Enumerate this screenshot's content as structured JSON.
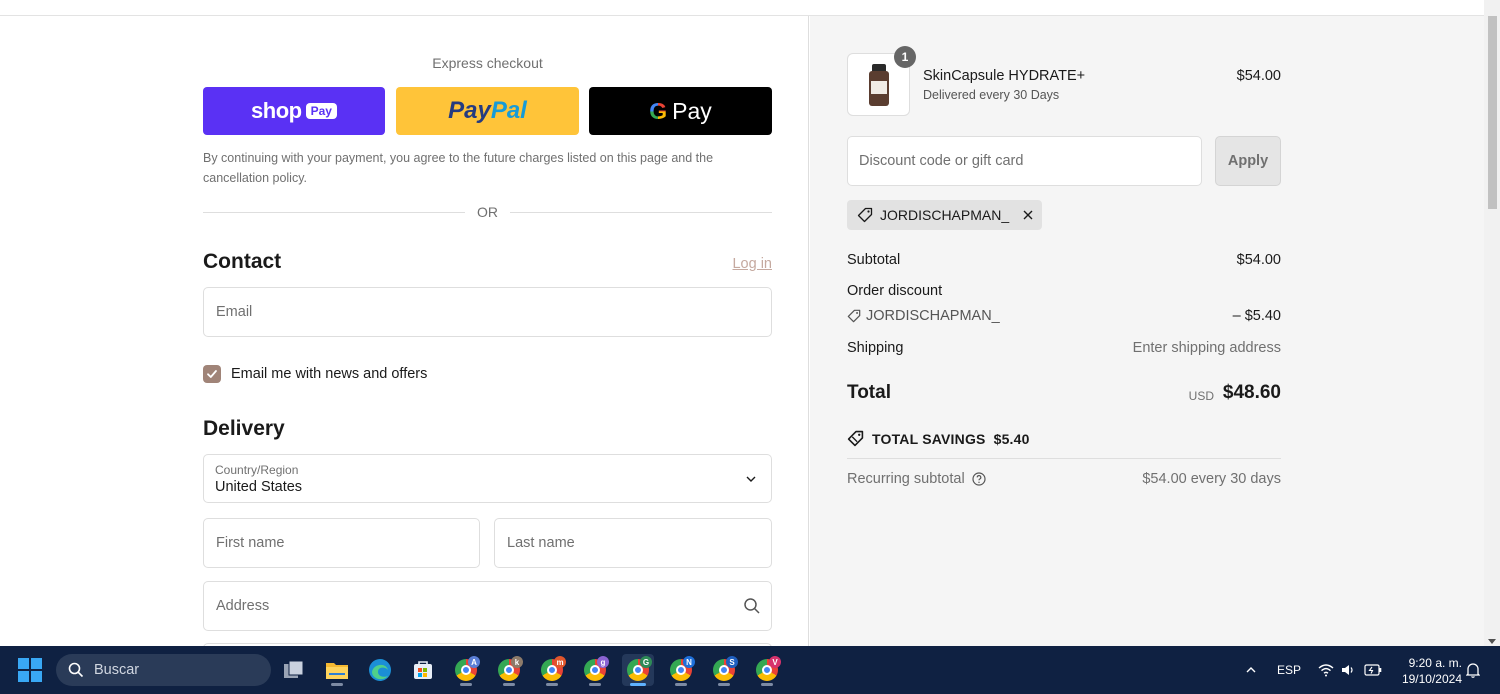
{
  "express": {
    "title": "Express checkout",
    "shop_pay": {
      "text": "shop",
      "badge": "Pay"
    },
    "paypal": {
      "part1": "Pay",
      "part2": "Pal"
    },
    "google_pay": {
      "g": "G",
      "text": "Pay"
    },
    "agreement": "By continuing with your payment, you agree to the future charges listed on this page and the cancellation policy.",
    "or_label": "OR"
  },
  "contact": {
    "heading": "Contact",
    "login_label": "Log in",
    "email_placeholder": "Email",
    "email_value": "",
    "newsletter_label": "Email me with news and offers",
    "newsletter_checked": true
  },
  "delivery": {
    "heading": "Delivery",
    "country_label": "Country/Region",
    "country_value": "United States",
    "first_name_placeholder": "First name",
    "last_name_placeholder": "Last name",
    "address_placeholder": "Address"
  },
  "order": {
    "product": {
      "name": "SkinCapsule HYDRATE+",
      "subtitle": "Delivered every 30 Days",
      "price": "$54.00",
      "quantity": "1"
    },
    "discount_placeholder": "Discount code or gift card",
    "discount_value": "",
    "apply_label": "Apply",
    "applied_code": "JORDISCHAPMAN_",
    "subtotal_label": "Subtotal",
    "subtotal_value": "$54.00",
    "order_discount_label": "Order discount",
    "discount_code": "JORDISCHAPMAN_",
    "discount_amount": "– $5.40",
    "shipping_label": "Shipping",
    "shipping_value": "Enter shipping address",
    "total_label": "Total",
    "total_currency": "USD",
    "total_value": "$48.60",
    "savings_label": "TOTAL SAVINGS",
    "savings_value": "$5.40",
    "recurring_label": "Recurring subtotal",
    "recurring_value": "$54.00 every 30 days"
  },
  "taskbar": {
    "search_label": "Buscar",
    "chrome_profiles": [
      {
        "letter": "A",
        "color": "#5b7fd6"
      },
      {
        "letter": "k",
        "color": "#8d7b6a"
      },
      {
        "letter": "m",
        "color": "#e0562c"
      },
      {
        "letter": "g",
        "color": "#8a63d2"
      },
      {
        "letter": "G",
        "color": "#2e8b57"
      },
      {
        "letter": "N",
        "color": "#1e6fd9"
      },
      {
        "letter": "S",
        "color": "#1f5fbf"
      },
      {
        "letter": "V",
        "color": "#d6336c"
      }
    ],
    "language": "ESP",
    "time": "9:20 a. m.",
    "date": "19/10/2024"
  },
  "colors": {
    "shop_pay": "#5a31f4",
    "paypal": "#ffc439",
    "google_pay": "#000000",
    "checkbox": "#a08478",
    "taskbar": "#0f2142"
  }
}
